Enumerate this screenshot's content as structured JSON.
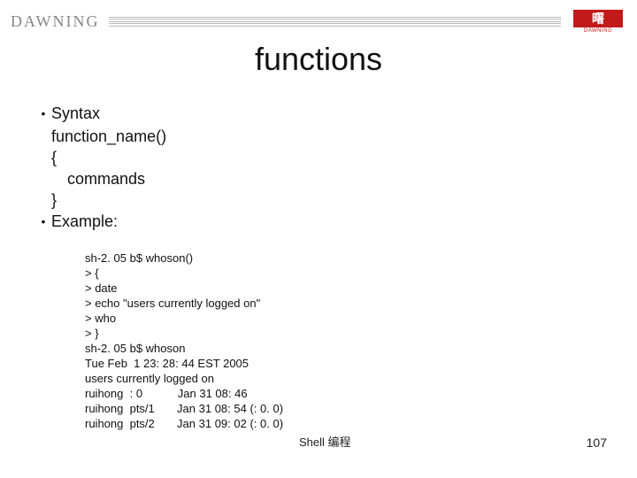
{
  "header": {
    "brand": "DAWNING",
    "logo_glyph": "曙",
    "logo_sub": "DAWNING"
  },
  "title": "functions",
  "bullets": {
    "b1": "Syntax",
    "b1_l1": "function_name()",
    "b1_l2": "{",
    "b1_l3": "commands",
    "b1_l4": "}",
    "b2": "Example:"
  },
  "example": {
    "l0": "sh-2. 05 b$ whoson()",
    "l1": "> {",
    "l2": "> date",
    "l3": "> echo \"users currently logged on\"",
    "l4": "> who",
    "l5": "> }",
    "l6": "sh-2. 05 b$ whoson",
    "l7": "Tue Feb  1 23: 28: 44 EST 2005",
    "l8": "users currently logged on",
    "l9": "ruihong  : 0           Jan 31 08: 46",
    "l10": "ruihong  pts/1       Jan 31 08: 54 (: 0. 0)",
    "l11": "ruihong  pts/2       Jan 31 09: 02 (: 0. 0)"
  },
  "footer": {
    "label": "Shell 编程",
    "page": "107"
  }
}
